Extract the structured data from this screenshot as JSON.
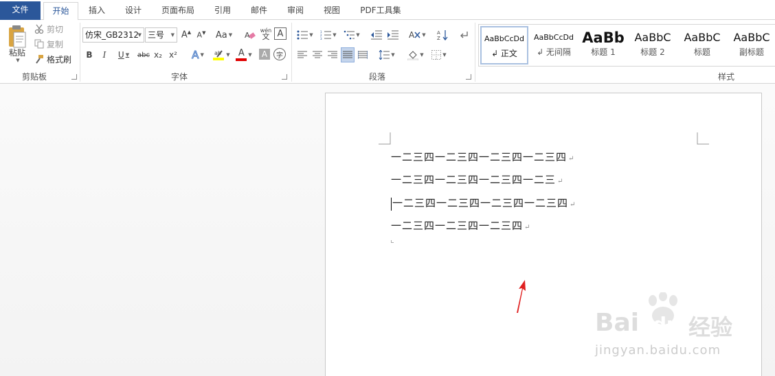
{
  "tabs": {
    "file": "文件",
    "home": "开始",
    "insert": "插入",
    "design": "设计",
    "layout": "页面布局",
    "references": "引用",
    "mailings": "邮件",
    "review": "审阅",
    "view": "视图",
    "pdf": "PDF工具集"
  },
  "clipboard": {
    "label": "剪贴板",
    "paste": "粘贴",
    "cut": "剪切",
    "copy": "复制",
    "format_painter": "格式刷"
  },
  "font": {
    "label": "字体",
    "font_name": "仿宋_GB2312",
    "font_size": "三号",
    "change_case": "Aa",
    "bold": "B",
    "italic": "I",
    "underline": "U",
    "strike": "abc",
    "subscript": "x₂",
    "superscript": "x²",
    "text_effects": "A",
    "font_color": "A",
    "char_shading": "A",
    "enclose": "字",
    "phonetic_top": "wén",
    "phonetic_bottom": "文",
    "char_border": "A"
  },
  "paragraph": {
    "label": "段落"
  },
  "styles": {
    "label": "样式",
    "items": [
      {
        "sample": "AaBbCcDd",
        "name": "↲ 正文"
      },
      {
        "sample": "AaBbCcDd",
        "name": "↲ 无间隔"
      },
      {
        "sample": "AaBb",
        "name": "标题 1"
      },
      {
        "sample": "AaBbC",
        "name": "标题 2"
      },
      {
        "sample": "AaBbC",
        "name": "标题"
      },
      {
        "sample": "AaBbC",
        "name": "副标题"
      }
    ]
  },
  "document": {
    "lines": [
      "一二三四一二三四一二三四一二三四",
      "一二三四一二三四一二三四一二三",
      "一二三四一二三四一二三四一二三四",
      "一二三四一二三四一二三四"
    ],
    "para_mark": "↵"
  },
  "watermark": {
    "brand": "Bai",
    "brand2": "du",
    "cn": "经验",
    "url": "jingyan.baidu.com"
  },
  "colors": {
    "accent": "#2b579a",
    "highlight": "#ffff00",
    "font_color": "#e00000",
    "arrow": "#e02020"
  }
}
